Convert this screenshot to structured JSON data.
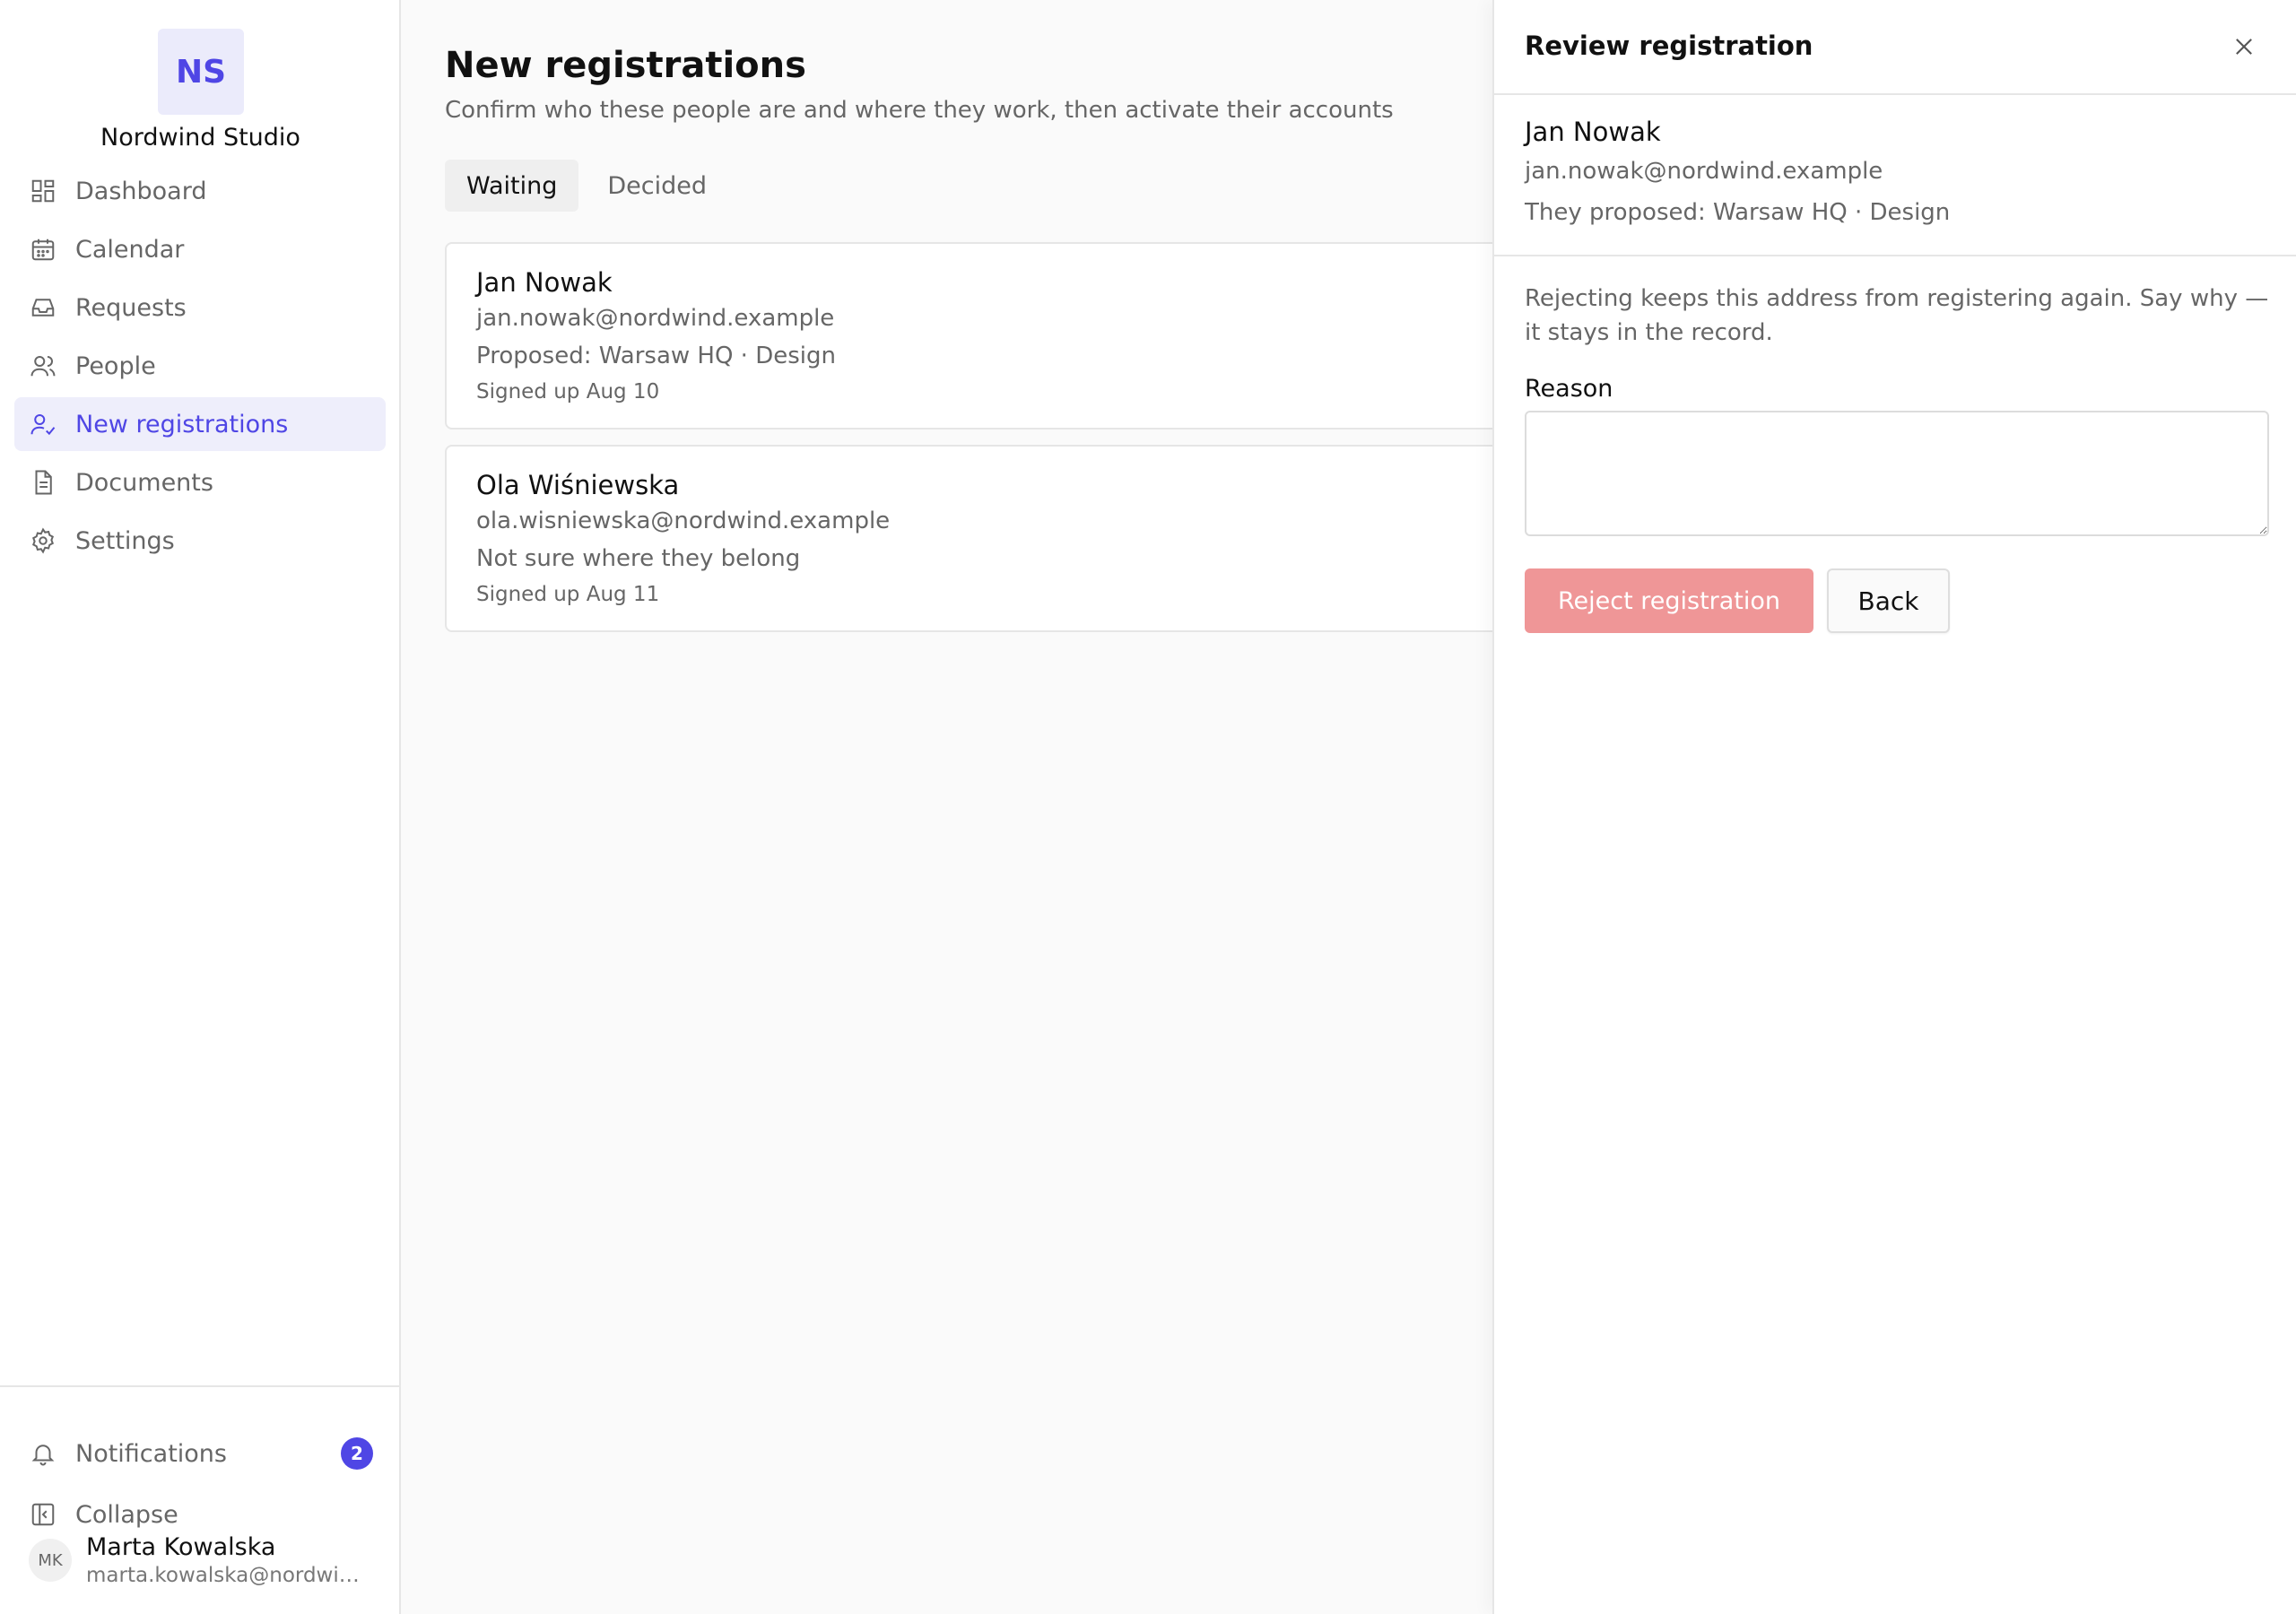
{
  "brand": {
    "initials": "NS",
    "name": "Nordwind Studio"
  },
  "nav": {
    "items": [
      {
        "label": "Dashboard",
        "icon": "dashboard-icon"
      },
      {
        "label": "Calendar",
        "icon": "calendar-icon"
      },
      {
        "label": "Requests",
        "icon": "inbox-icon"
      },
      {
        "label": "People",
        "icon": "people-icon"
      },
      {
        "label": "New registrations",
        "icon": "user-check-icon",
        "active": true
      },
      {
        "label": "Documents",
        "icon": "document-icon"
      },
      {
        "label": "Settings",
        "icon": "gear-icon"
      }
    ]
  },
  "sidebar_bottom": {
    "notifications_label": "Notifications",
    "notifications_count": "2",
    "collapse_label": "Collapse",
    "user": {
      "initials": "MK",
      "name": "Marta Kowalska",
      "email": "marta.kowalska@nordwind.example"
    }
  },
  "main": {
    "title": "New registrations",
    "subtitle": "Confirm who these people are and where they work, then activate their accounts",
    "tabs": [
      {
        "label": "Waiting",
        "active": true
      },
      {
        "label": "Decided",
        "active": false
      }
    ],
    "registrations": [
      {
        "name": "Jan Nowak",
        "email": "jan.nowak@nordwind.example",
        "proposal": "Proposed: Warsaw HQ · Design",
        "signed_up": "Signed up Aug 10"
      },
      {
        "name": "Ola Wiśniewska",
        "email": "ola.wisniewska@nordwind.example",
        "proposal": "Not sure where they belong",
        "signed_up": "Signed up Aug 11"
      }
    ]
  },
  "drawer": {
    "title": "Review registration",
    "name": "Jan Nowak",
    "email": "jan.nowak@nordwind.example",
    "proposal": "They proposed: Warsaw HQ · Design",
    "warning": "Rejecting keeps this address from registering again. Say why — it stays in the record.",
    "reason_label": "Reason",
    "reason_value": "",
    "reject_label": "Reject registration",
    "back_label": "Back"
  },
  "colors": {
    "accent": "#4f46e5",
    "reject": "#ef9697"
  }
}
